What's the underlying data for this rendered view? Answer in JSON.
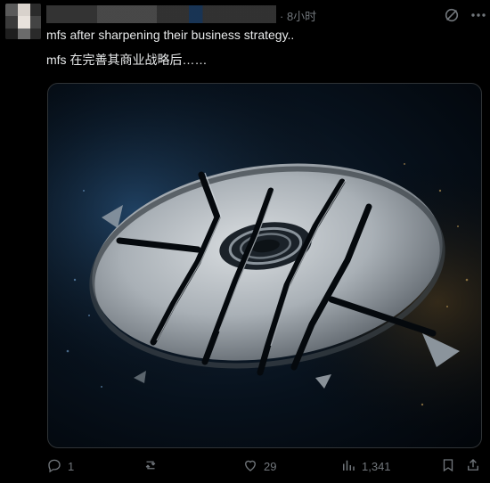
{
  "post": {
    "time": "· 8小时",
    "text_en": "mfs after sharpening their business strategy..",
    "text_zh": "mfs 在完善其商业战略后……",
    "media_icon": "broken-disc-image"
  },
  "actions": {
    "reply_count": "1",
    "retweet_count": "",
    "like_count": "29",
    "views_count": "1,341"
  },
  "icons": {
    "reply": "reply-icon",
    "retweet": "retweet-icon",
    "like": "heart-icon",
    "views": "views-chart-icon",
    "bookmark": "bookmark-icon",
    "share": "share-icon",
    "grok": "grok-icon",
    "more": "more-icon"
  },
  "colors": {
    "background": "#000000",
    "text": "#e7e9ea",
    "muted": "#71767b",
    "border": "#2f3336"
  }
}
